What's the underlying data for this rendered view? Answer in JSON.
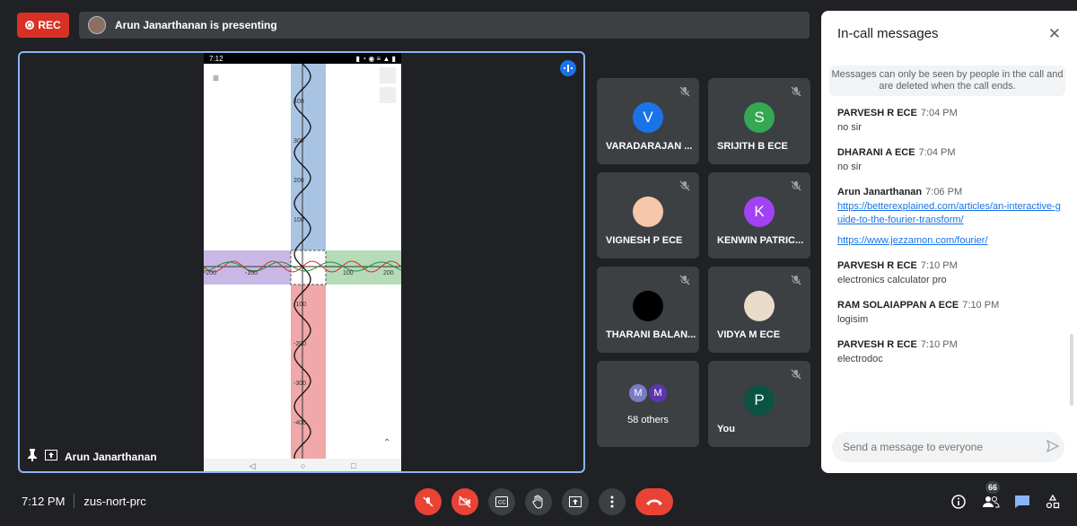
{
  "top": {
    "rec_label": "REC",
    "presenting_text": "Arun Janarthanan is presenting"
  },
  "stage": {
    "presenter_name": "Arun Janarthanan",
    "phone_time": "7:12",
    "graph_y_labels": [
      "400",
      "300",
      "200",
      "100",
      "-100",
      "-200",
      "-300",
      "-400"
    ],
    "graph_x_labels": [
      "-200",
      "-100",
      "100",
      "200"
    ]
  },
  "tiles": [
    {
      "name": "VARADARAJAN ...",
      "initial": "V",
      "color": "#1a73e8",
      "type": "initial"
    },
    {
      "name": "SRIJITH B ECE",
      "initial": "S",
      "color": "#34a853",
      "type": "initial"
    },
    {
      "name": "VIGNESH P ECE",
      "initial": "",
      "color": "#f6c7a8",
      "type": "photo"
    },
    {
      "name": "KENWIN PATRIC...",
      "initial": "K",
      "color": "#a142f4",
      "type": "initial"
    },
    {
      "name": "THARANI BALAN...",
      "initial": "",
      "color": "#000000",
      "type": "photo"
    },
    {
      "name": "VIDYA M ECE",
      "initial": "",
      "color": "#e8dcc8",
      "type": "photo"
    },
    {
      "name": "58 others",
      "initial": "M",
      "color": "#5e35b1",
      "type": "group"
    },
    {
      "name": "You",
      "initial": "P",
      "color": "#0b5345",
      "type": "initial"
    }
  ],
  "chat": {
    "title": "In-call messages",
    "notice": "Messages can only be seen by people in the call and are deleted when the call ends.",
    "messages": [
      {
        "sender": "PARVESH R ECE",
        "time": "7:04 PM",
        "text": "no sir"
      },
      {
        "sender": "DHARANI A ECE",
        "time": "7:04 PM",
        "text": "no sir"
      },
      {
        "sender": "Arun Janarthanan",
        "time": "7:06 PM",
        "link1": "https://betterexplained.com/articles/an-interactive-guide-to-the-fourier-transform/",
        "link2": "https://www.jezzamon.com/fourier/"
      },
      {
        "sender": "PARVESH R ECE",
        "time": "7:10 PM",
        "text": "electronics calculator pro"
      },
      {
        "sender": "RAM SOLAIAPPAN A ECE",
        "time": "7:10 PM",
        "text": "logisim"
      },
      {
        "sender": "PARVESH R ECE",
        "time": "7:10 PM",
        "text": "electrodoc"
      }
    ],
    "input_placeholder": "Send a message to everyone"
  },
  "bottom": {
    "time": "7:12 PM",
    "meeting_code": "zus-nort-prc",
    "participant_count": "66"
  },
  "colors": {
    "accent": "#8ab4f8",
    "danger": "#ea4335",
    "link": "#1a73e8"
  }
}
